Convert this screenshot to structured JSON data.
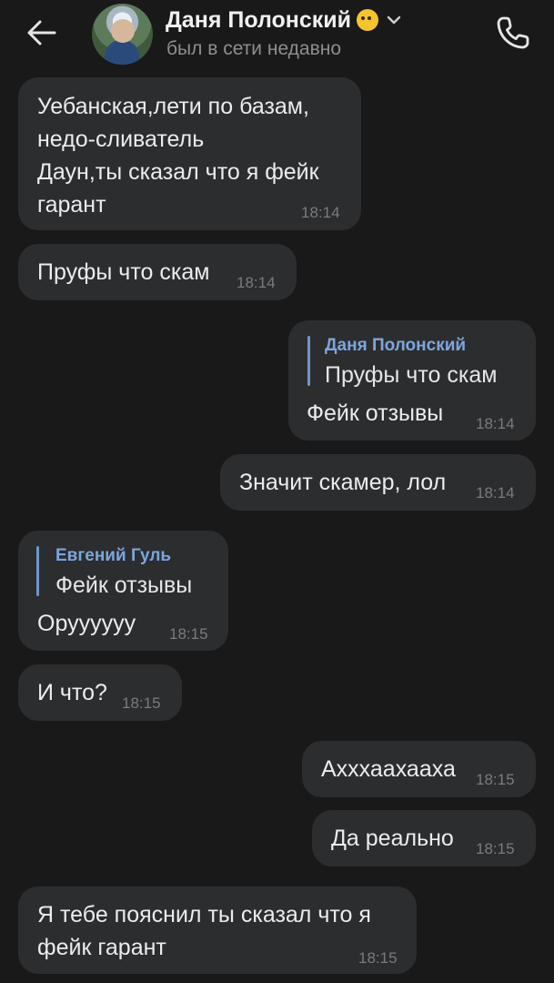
{
  "header": {
    "contact_name": "Даня Полонский",
    "status": "был в сети недавно",
    "icons": {
      "back": "arrow-left-icon",
      "avatar": "avatar",
      "emoji": "emoji-icon",
      "chevron": "chevron-down-icon",
      "call": "phone-icon"
    }
  },
  "messages": [
    {
      "side": "in",
      "lines": [
        "Уебанская,лети по базам,",
        "недо-сливатель",
        "Даун,ты сказал что я фейк",
        "гарант"
      ],
      "time": "18:14"
    },
    {
      "side": "in",
      "lines": [
        "Пруфы что скам"
      ],
      "time": "18:14"
    },
    {
      "side": "out",
      "reply": {
        "author": "Даня Полонский",
        "text": "Пруфы что скам"
      },
      "lines": [
        "Фейк отзывы"
      ],
      "time": "18:14"
    },
    {
      "side": "out",
      "lines": [
        "Значит скамер, лол"
      ],
      "time": "18:14"
    },
    {
      "side": "in",
      "reply": {
        "author": "Евгений Гуль",
        "text": "Фейк отзывы"
      },
      "lines": [
        "Орууууyy"
      ],
      "time": "18:15"
    },
    {
      "side": "in",
      "lines": [
        "И что?"
      ],
      "time": "18:15"
    },
    {
      "side": "out",
      "lines": [
        "Ахххаахааха"
      ],
      "time": "18:15"
    },
    {
      "side": "out",
      "lines": [
        "Да реально"
      ],
      "time": "18:15"
    },
    {
      "side": "in",
      "lines": [
        "Я тебе пояснил ты сказал что я",
        "фейк гарант"
      ],
      "time": "18:15"
    }
  ],
  "colors": {
    "background": "#19191a",
    "bubble": "#2c2d2f",
    "reply_accent": "#6d97cc"
  }
}
